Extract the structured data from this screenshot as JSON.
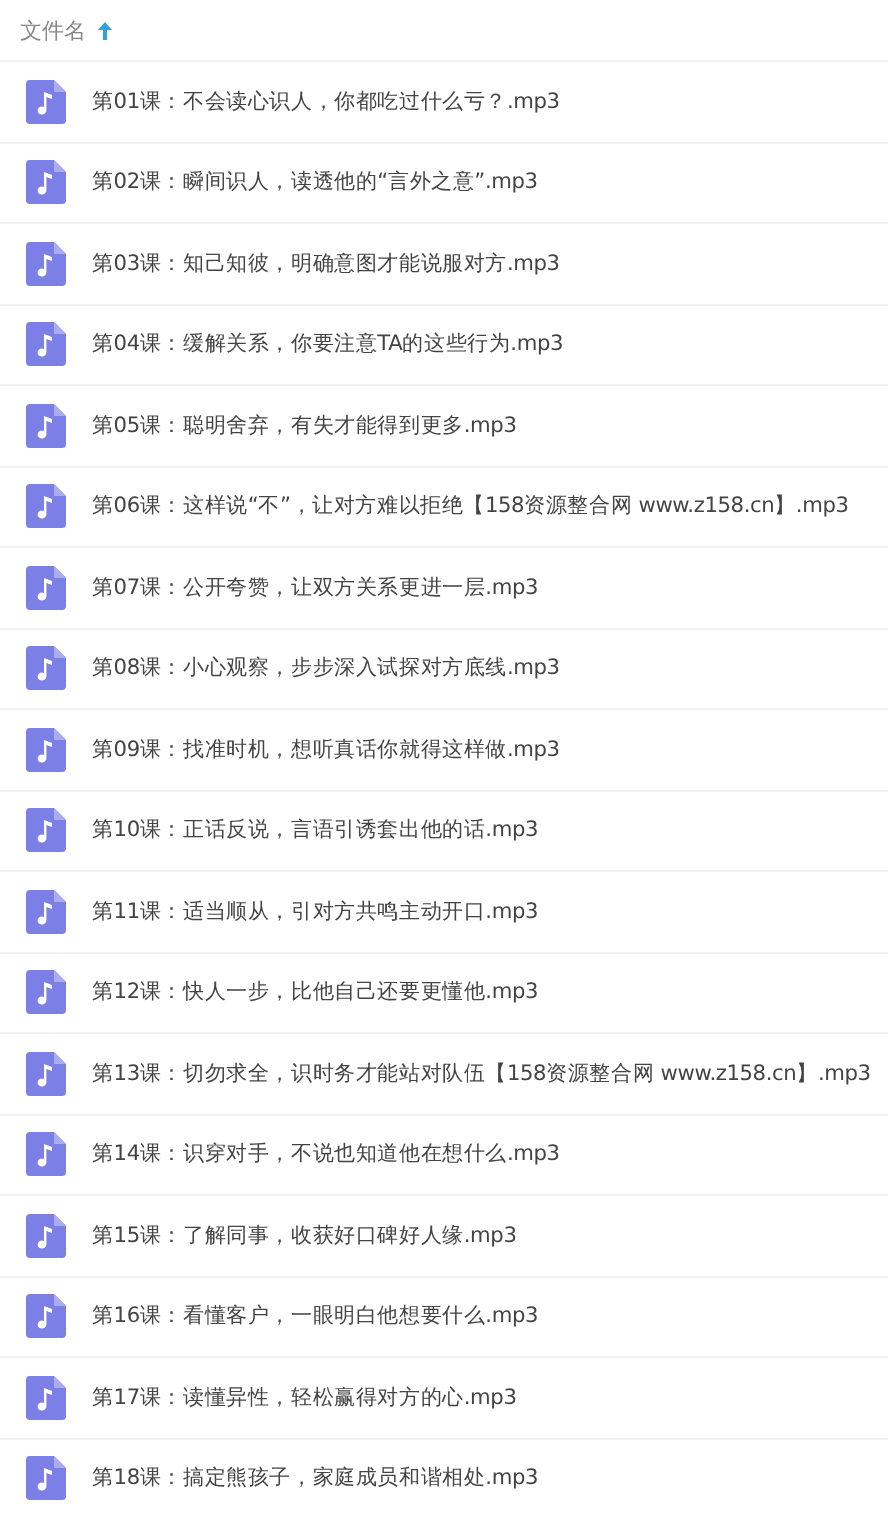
{
  "header": {
    "label": "文件名",
    "sort_ascending": true
  },
  "files": [
    {
      "name": "第01课：不会读心识人，你都吃过什么亏？.mp3"
    },
    {
      "name": "第02课：瞬间识人，读透他的“言外之意”.mp3"
    },
    {
      "name": "第03课：知己知彼，明确意图才能说服对方.mp3"
    },
    {
      "name": "第04课：缓解关系，你要注意TA的这些行为.mp3"
    },
    {
      "name": "第05课：聪明舍弃，有失才能得到更多.mp3"
    },
    {
      "name": "第06课：这样说“不”，让对方难以拒绝【158资源整合网 www.z158.cn】.mp3"
    },
    {
      "name": "第07课：公开夸赞，让双方关系更进一层.mp3"
    },
    {
      "name": "第08课：小心观察，步步深入试探对方底线.mp3"
    },
    {
      "name": "第09课：找准时机，想听真话你就得这样做.mp3"
    },
    {
      "name": "第10课：正话反说，言语引诱套出他的话.mp3"
    },
    {
      "name": "第11课：适当顺从，引对方共鸣主动开口.mp3"
    },
    {
      "name": "第12课：快人一步，比他自己还要更懂他.mp3"
    },
    {
      "name": "第13课：切勿求全，识时务才能站对队伍【158资源整合网 www.z158.cn】.mp3"
    },
    {
      "name": "第14课：识穿对手，不说也知道他在想什么.mp3"
    },
    {
      "name": "第15课：了解同事，收获好口碑好人缘.mp3"
    },
    {
      "name": "第16课：看懂客户，一眼明白他想要什么.mp3"
    },
    {
      "name": "第17课：读懂异性，轻松赢得对方的心.mp3"
    },
    {
      "name": "第18课：搞定熊孩子，家庭成员和谐相处.mp3"
    }
  ]
}
